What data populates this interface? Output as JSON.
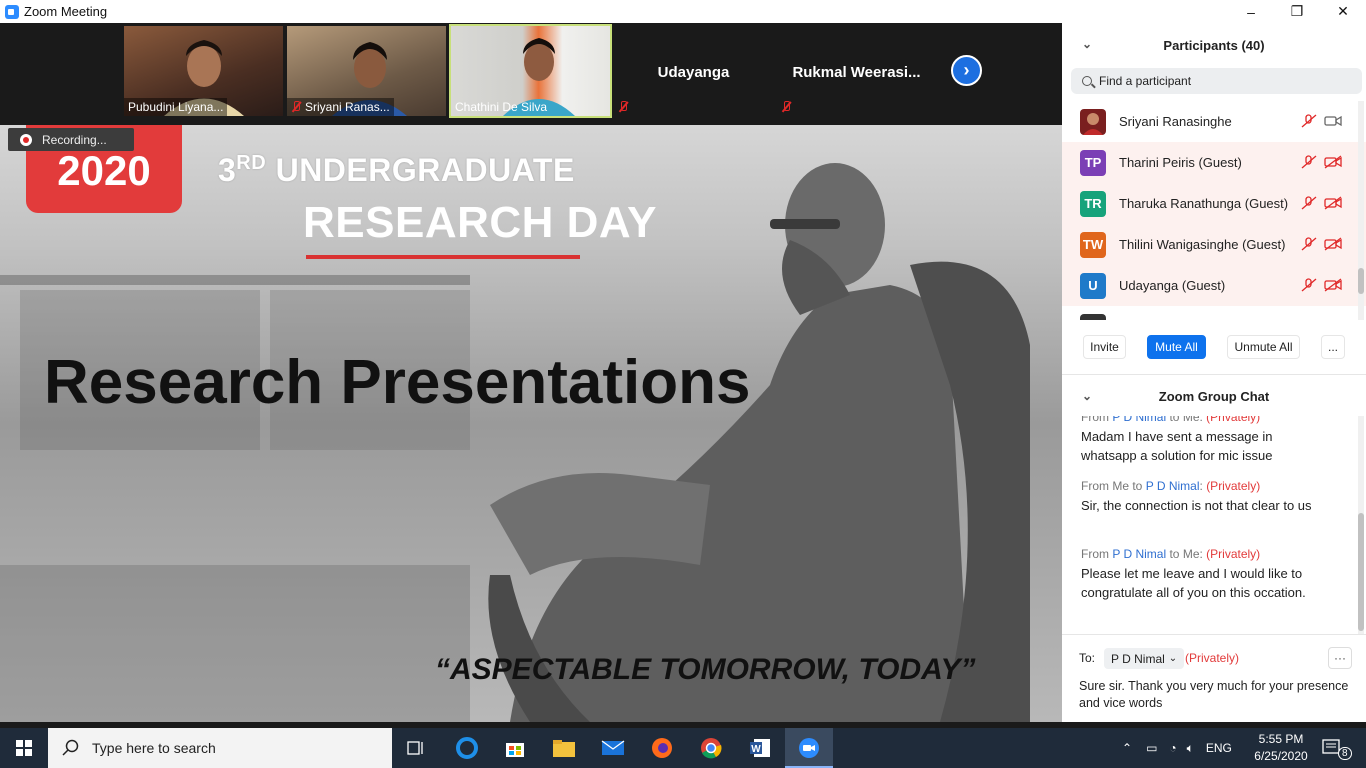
{
  "window": {
    "title": "Zoom Meeting",
    "controls": [
      "–",
      "❐",
      "✕"
    ]
  },
  "video_strip": {
    "tiles": [
      {
        "name": "Pubudini Liyana..."
      },
      {
        "name": "Sriyani Ranas..."
      },
      {
        "name": "Chathini De Silva"
      },
      {
        "name": "Udayanga"
      },
      {
        "name": "Rukmal  Weerasi..."
      }
    ],
    "next_icon": "chevron-right-icon"
  },
  "share": {
    "recording_label": "Recording...",
    "year": "2020",
    "headline_ordinal": "3",
    "headline_suffix": "RD",
    "headline_line1": " UNDERGRADUATE",
    "headline_line2": "RESEARCH DAY",
    "main_title": "Research Presentations",
    "tagline": "“ASPECTABLE TOMORROW, TODAY”"
  },
  "participants": {
    "header": "Participants (40)",
    "search_placeholder": "Find a participant",
    "items": [
      {
        "initials": "",
        "name": "Sriyani Ranasinghe",
        "color": "#7a1f1f"
      },
      {
        "initials": "TP",
        "name": "Tharini Peiris (Guest)",
        "color": "#7b3fb5"
      },
      {
        "initials": "TR",
        "name": "Tharuka Ranathunga (Guest)",
        "color": "#17a37b"
      },
      {
        "initials": "TW",
        "name": "Thilini Wanigasinghe (Guest)",
        "color": "#e0661c"
      },
      {
        "initials": "U",
        "name": "Udayanga (Guest)",
        "color": "#1f7ac9"
      }
    ],
    "buttons": {
      "invite": "Invite",
      "mute_all": "Mute All",
      "unmute_all": "Unmute All",
      "more": "..."
    }
  },
  "chat": {
    "header": "Zoom Group Chat",
    "messages": [
      {
        "from_prefix": "From ",
        "from": "P D Nimal",
        "to_text": " to Me:",
        "privately": "(Privately)",
        "text": "Madam I have sent a message in whatsapp a solution for mic issue"
      },
      {
        "from_prefix": "From ",
        "from": "Me",
        "to_text": " to ",
        "to": "P D Nimal",
        "colon": ":",
        "privately": "(Privately)",
        "text": "Sir, the connection is not that clear to us"
      },
      {
        "from_prefix": "From ",
        "from": "P D Nimal",
        "to_text": " to Me:",
        "privately": "(Privately)",
        "text": "Please let me leave and I would like to congratulate all of you on this occation."
      }
    ],
    "compose": {
      "to_label": "To:",
      "to_value": "P D Nimal",
      "privately": "(Privately)",
      "more": "···",
      "text": "Sure sir. Thank you very much for your presence and vice words"
    }
  },
  "taskbar": {
    "search_placeholder": "Type here to search",
    "language": "ENG",
    "time": "5:55 PM",
    "date": "6/25/2020",
    "notification_count": "8",
    "apps": [
      "task-view-icon",
      "edge-icon",
      "store-icon",
      "file-explorer-icon",
      "mail-icon",
      "firefox-icon",
      "chrome-icon",
      "word-icon",
      "zoom-icon"
    ]
  },
  "colors": {
    "accent_blue": "#0e72ed",
    "brand_red": "#e23b3b",
    "taskbar": "#1f2b3a"
  }
}
